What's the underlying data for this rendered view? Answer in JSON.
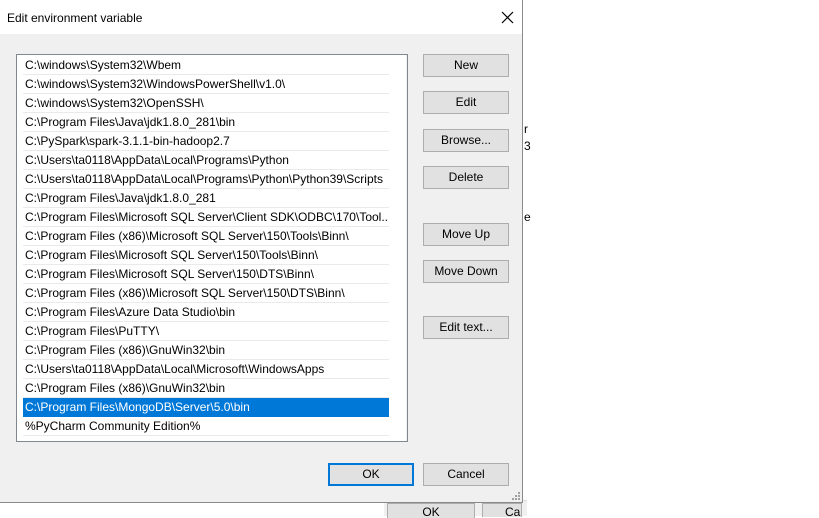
{
  "dialog": {
    "title": "Edit environment variable",
    "selected_index": 18,
    "items": [
      "C:\\windows\\System32\\Wbem",
      "C:\\windows\\System32\\WindowsPowerShell\\v1.0\\",
      "C:\\windows\\System32\\OpenSSH\\",
      "C:\\Program Files\\Java\\jdk1.8.0_281\\bin",
      "C:\\PySpark\\spark-3.1.1-bin-hadoop2.7",
      "C:\\Users\\ta0118\\AppData\\Local\\Programs\\Python",
      "C:\\Users\\ta0118\\AppData\\Local\\Programs\\Python\\Python39\\Scripts",
      "C:\\Program Files\\Java\\jdk1.8.0_281",
      "C:\\Program Files\\Microsoft SQL Server\\Client SDK\\ODBC\\170\\Tool...",
      "C:\\Program Files (x86)\\Microsoft SQL Server\\150\\Tools\\Binn\\",
      "C:\\Program Files\\Microsoft SQL Server\\150\\Tools\\Binn\\",
      "C:\\Program Files\\Microsoft SQL Server\\150\\DTS\\Binn\\",
      "C:\\Program Files (x86)\\Microsoft SQL Server\\150\\DTS\\Binn\\",
      "C:\\Program Files\\Azure Data Studio\\bin",
      "C:\\Program Files\\PuTTY\\",
      "C:\\Program Files (x86)\\GnuWin32\\bin",
      "C:\\Users\\ta0118\\AppData\\Local\\Microsoft\\WindowsApps",
      "C:\\Program Files (x86)\\GnuWin32\\bin",
      "C:\\Program Files\\MongoDB\\Server\\5.0\\bin",
      "%PyCharm Community Edition%"
    ],
    "buttons": {
      "new": "New",
      "edit": "Edit",
      "browse": "Browse...",
      "delete": "Delete",
      "move_up": "Move Up",
      "move_down": "Move Down",
      "edit_text": "Edit text...",
      "ok": "OK",
      "cancel": "Cancel"
    },
    "close_icon": "close-icon",
    "selection_color": "#0078d7"
  },
  "background": {
    "fragments": [
      "r",
      "3",
      "e"
    ],
    "ok_label": "OK",
    "cancel_label": "Can"
  }
}
